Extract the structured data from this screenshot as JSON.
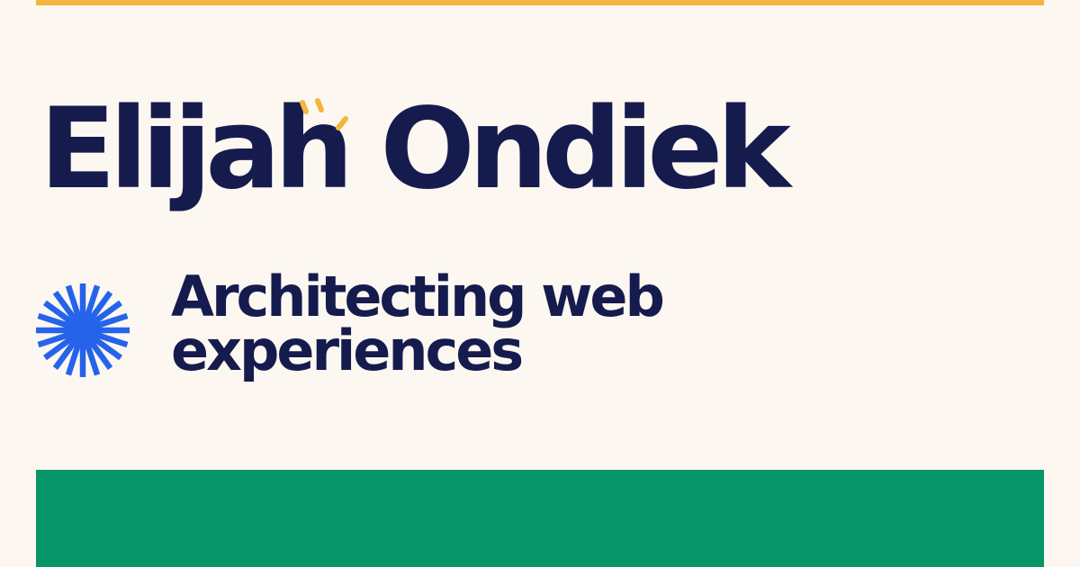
{
  "header": {
    "name": "Elijah Ondiek"
  },
  "tagline": {
    "line1": "Architecting web",
    "line2": "experiences"
  },
  "colors": {
    "background": "#fcf8f1",
    "text": "#161b4e",
    "accent_yellow": "#f2b63c",
    "accent_blue": "#2563eb",
    "accent_green": "#069669"
  },
  "icons": {
    "burst": "starburst-icon",
    "spark": "spark-lines-icon"
  }
}
